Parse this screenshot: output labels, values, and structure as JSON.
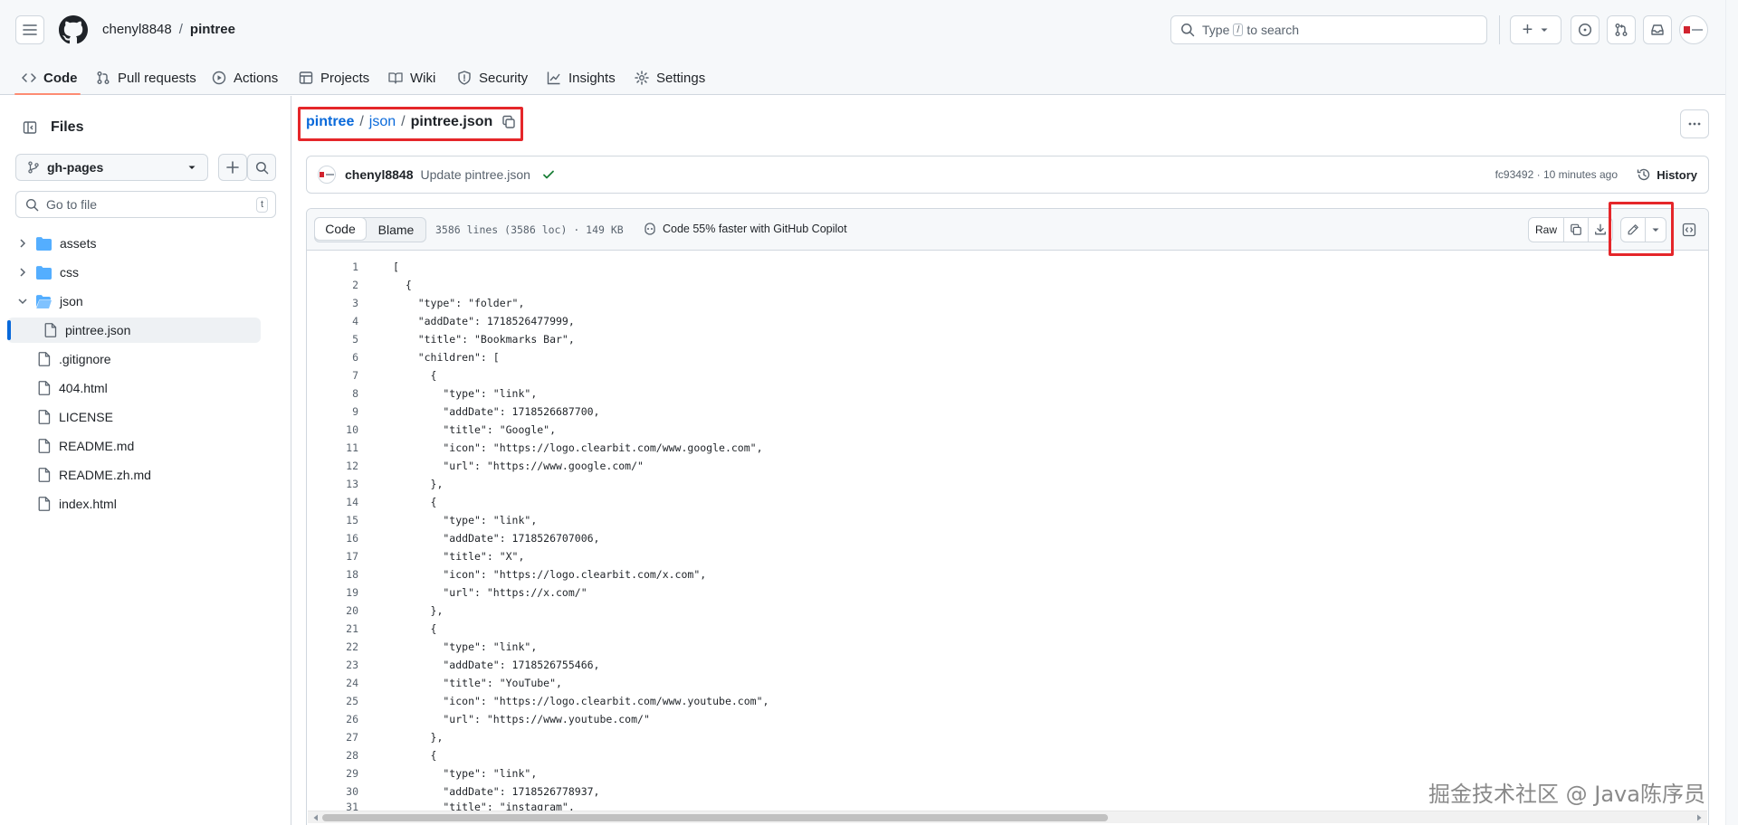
{
  "header": {
    "owner": "chenyl8848",
    "separator": "/",
    "repo": "pintree",
    "search_placeholder": "Type / to search",
    "search_prefix": "Type",
    "search_key": "/",
    "search_suffix": "to search",
    "plus": "+"
  },
  "nav": {
    "tabs": [
      {
        "label": "Code"
      },
      {
        "label": "Pull requests"
      },
      {
        "label": "Actions"
      },
      {
        "label": "Projects"
      },
      {
        "label": "Wiki"
      },
      {
        "label": "Security"
      },
      {
        "label": "Insights"
      },
      {
        "label": "Settings"
      }
    ]
  },
  "sidebar": {
    "title": "Files",
    "branch": "gh-pages",
    "goto_placeholder": "Go to file",
    "goto_shortcut": "t",
    "tree": [
      {
        "label": "assets",
        "type": "folder"
      },
      {
        "label": "css",
        "type": "folder"
      },
      {
        "label": "json",
        "type": "folder-open"
      },
      {
        "label": "pintree.json",
        "type": "file"
      },
      {
        "label": ".gitignore",
        "type": "file"
      },
      {
        "label": "404.html",
        "type": "file"
      },
      {
        "label": "LICENSE",
        "type": "file"
      },
      {
        "label": "README.md",
        "type": "file"
      },
      {
        "label": "README.zh.md",
        "type": "file"
      },
      {
        "label": "index.html",
        "type": "file"
      }
    ]
  },
  "breadcrumb": {
    "repo": "pintree",
    "sep1": "/",
    "dir": "json",
    "sep2": "/",
    "file": "pintree.json"
  },
  "commit": {
    "author": "chenyl8848",
    "message": "Update pintree.json",
    "sha_time": "fc93492 · 10 minutes ago",
    "history": "History"
  },
  "file_toolbar": {
    "code_tab": "Code",
    "blame_tab": "Blame",
    "stats": "3586 lines (3586 loc) · 149 KB",
    "copilot": "Code 55% faster with GitHub Copilot",
    "raw": "Raw"
  },
  "code_lines": [
    "[",
    "  {",
    "    \"type\": \"folder\",",
    "    \"addDate\": 1718526477999,",
    "    \"title\": \"Bookmarks Bar\",",
    "    \"children\": [",
    "      {",
    "        \"type\": \"link\",",
    "        \"addDate\": 1718526687700,",
    "        \"title\": \"Google\",",
    "        \"icon\": \"https://logo.clearbit.com/www.google.com\",",
    "        \"url\": \"https://www.google.com/\"",
    "      },",
    "      {",
    "        \"type\": \"link\",",
    "        \"addDate\": 1718526707006,",
    "        \"title\": \"X\",",
    "        \"icon\": \"https://logo.clearbit.com/x.com\",",
    "        \"url\": \"https://x.com/\"",
    "      },",
    "      {",
    "        \"type\": \"link\",",
    "        \"addDate\": 1718526755466,",
    "        \"title\": \"YouTube\",",
    "        \"icon\": \"https://logo.clearbit.com/www.youtube.com\",",
    "        \"url\": \"https://www.youtube.com/\"",
    "      },",
    "      {",
    "        \"type\": \"link\",",
    "        \"addDate\": 1718526778937,",
    "        \"title\": \"instagram\","
  ],
  "watermark": "掘金技术社区 @ Java陈序员",
  "colors": {
    "accent": "#0969da",
    "highlight_box": "#e5262a",
    "tab_underline": "#fd8c73",
    "folder": "#54aeff",
    "success": "#1a7f37"
  }
}
